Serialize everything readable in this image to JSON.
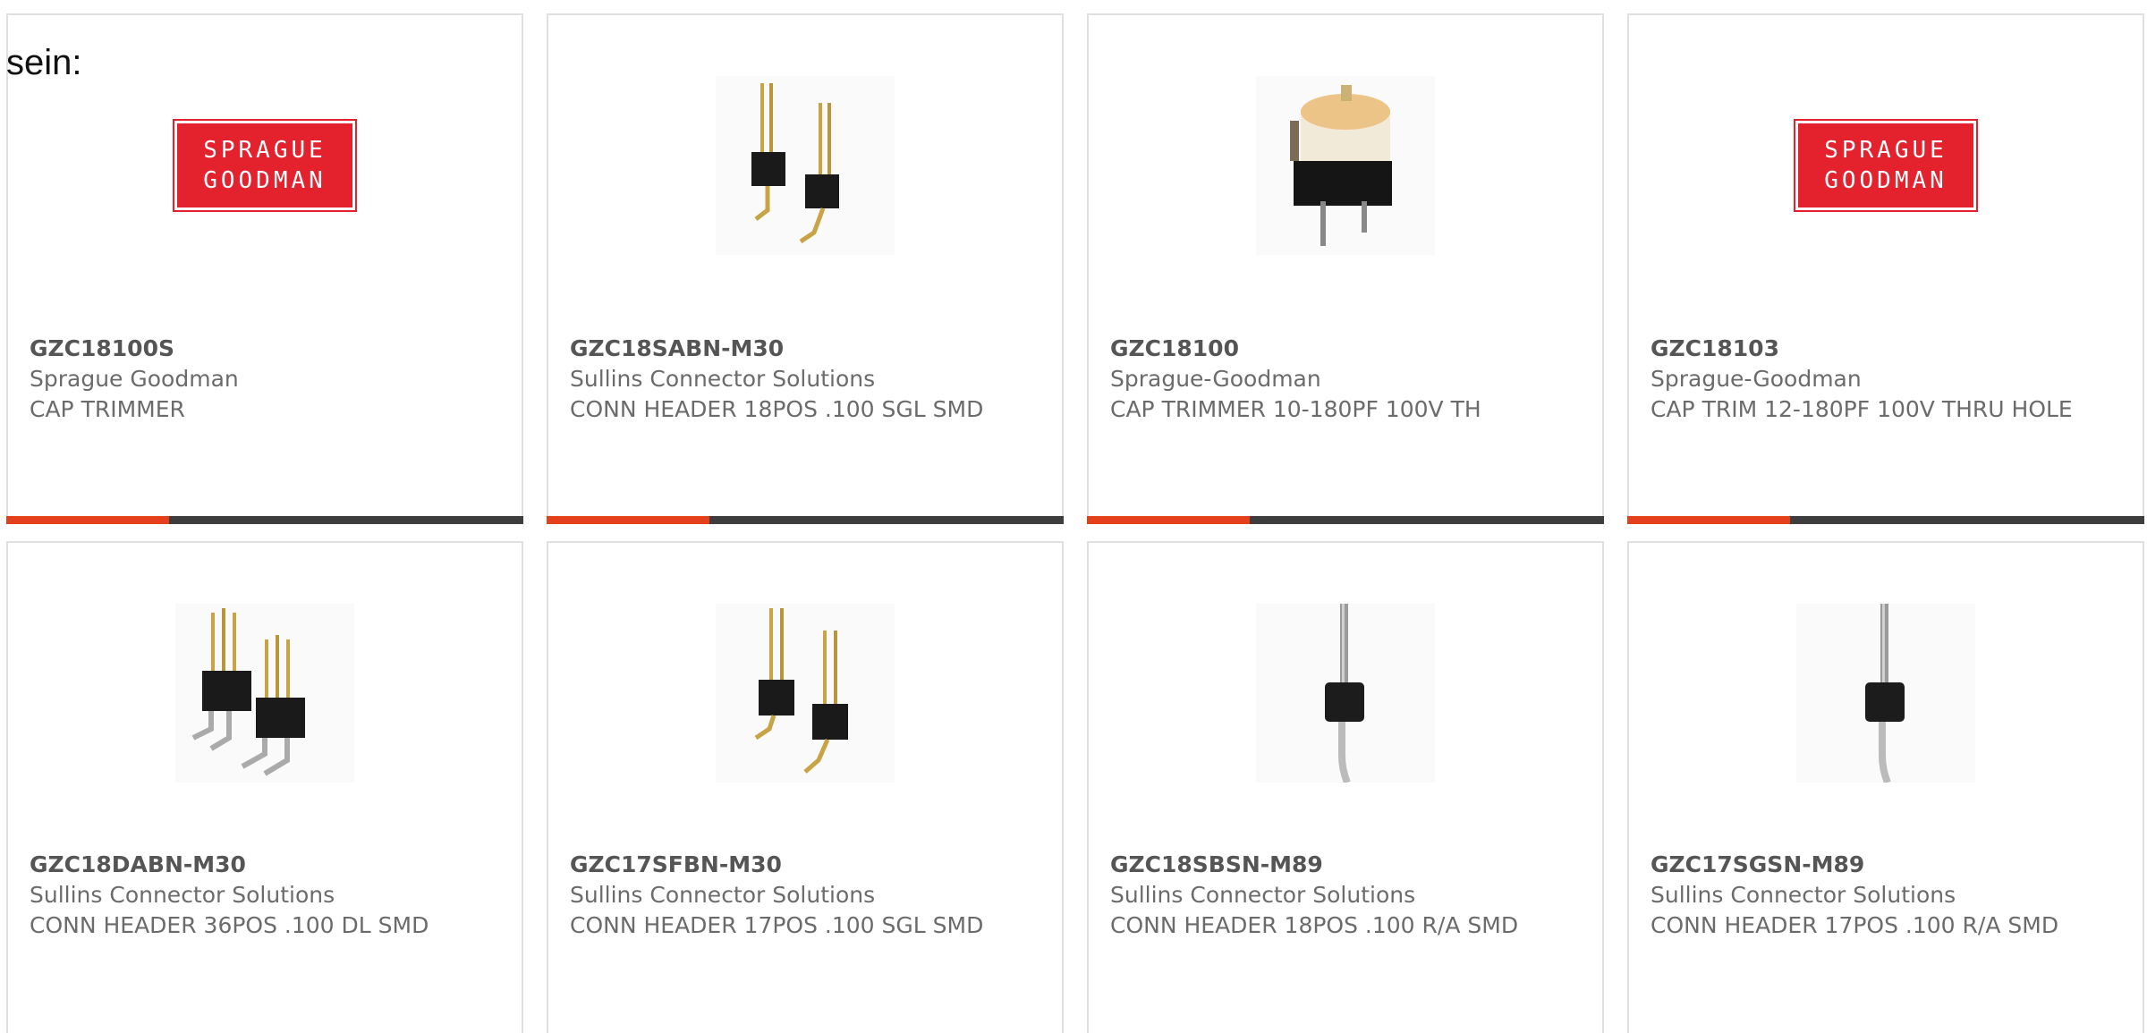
{
  "intro_text": "sein:",
  "accent_color": "#e3401b",
  "bar_color": "#3d3d3d",
  "products": [
    {
      "part_number": "GZC18100S",
      "manufacturer": "Sprague Goodman",
      "description": "CAP TRIMMER",
      "image": "sprague-goodman-logo",
      "logo_lines": [
        "SPRAGUE",
        "GOODMAN"
      ]
    },
    {
      "part_number": "GZC18SABN-M30",
      "manufacturer": "Sullins Connector Solutions",
      "description": "CONN HEADER 18POS .100 SGL SMD",
      "image": "pin-header-single-row-photo"
    },
    {
      "part_number": "GZC18100",
      "manufacturer": "Sprague-Goodman",
      "description": "CAP TRIMMER 10-180PF 100V TH",
      "image": "trimmer-capacitor-photo"
    },
    {
      "part_number": "GZC18103",
      "manufacturer": "Sprague-Goodman",
      "description": "CAP TRIM 12-180PF 100V THRU HOLE",
      "image": "sprague-goodman-logo",
      "logo_lines": [
        "SPRAGUE",
        "GOODMAN"
      ]
    },
    {
      "part_number": "GZC18DABN-M30",
      "manufacturer": "Sullins Connector Solutions",
      "description": "CONN HEADER 36POS .100 DL SMD",
      "image": "pin-header-dual-row-photo"
    },
    {
      "part_number": "GZC17SFBN-M30",
      "manufacturer": "Sullins Connector Solutions",
      "description": "CONN HEADER 17POS .100 SGL SMD",
      "image": "pin-header-single-row-photo"
    },
    {
      "part_number": "GZC18SBSN-M89",
      "manufacturer": "Sullins Connector Solutions",
      "description": "CONN HEADER 18POS .100 R/A SMD",
      "image": "single-pin-right-angle-photo"
    },
    {
      "part_number": "GZC17SGSN-M89",
      "manufacturer": "Sullins Connector Solutions",
      "description": "CONN HEADER 17POS .100 R/A SMD",
      "image": "single-pin-right-angle-photo"
    }
  ]
}
